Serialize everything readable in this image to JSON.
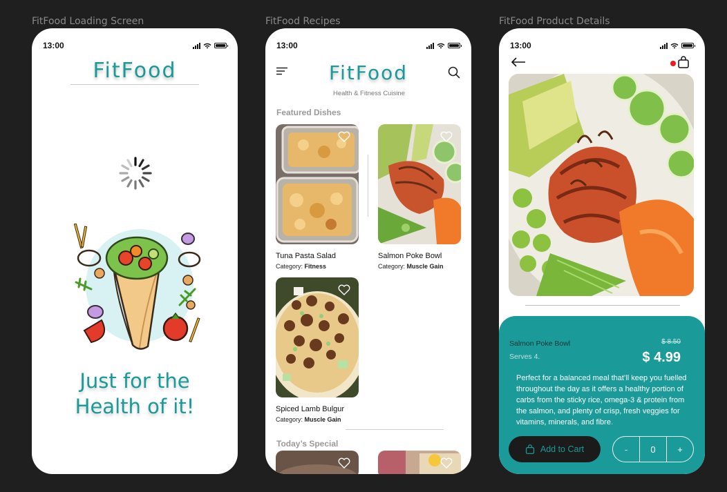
{
  "frames": {
    "loading": "FitFood Loading Screen",
    "recipes": "FitFood Recipes",
    "details": "FitFood Product Details"
  },
  "status_time": "13:00",
  "colors": {
    "brand": "#1a9a98",
    "dark": "#1b1b1b",
    "badge": "#e81d1d"
  },
  "loading": {
    "logo": "FitFood",
    "tagline_line1": "Just for the",
    "tagline_line2": "Health of it!"
  },
  "recipes": {
    "logo": "FitFood",
    "subtitle": "Health & Fitness  Cuisine",
    "featured_title": "Featured Dishes",
    "special_title": "Today’s Special",
    "category_prefix": "Category: ",
    "dishes": [
      {
        "name": "Tuna Pasta Salad",
        "category": "Fitness"
      },
      {
        "name": "Salmon Poke Bowl",
        "category": "Muscle Gain"
      },
      {
        "name": "Spiced Lamb Bulgur",
        "category": "Muscle Gain"
      }
    ]
  },
  "details": {
    "name": "Salmon Poke Bowl",
    "serves": "Serves 4.",
    "old_price": "$ 8.50",
    "price": "$ 4.99",
    "description": "Perfect for a balanced meal that’ll keep you fuelled throughout the day as it offers a healthy portion of carbs from the sticky rice, omega-3 & protein from the salmon, and plenty of crisp, fresh veggies for vitamins, minerals, and fibre.",
    "add_to_cart": "Add to Cart",
    "minus": "-",
    "quantity": "0",
    "plus": "+"
  }
}
